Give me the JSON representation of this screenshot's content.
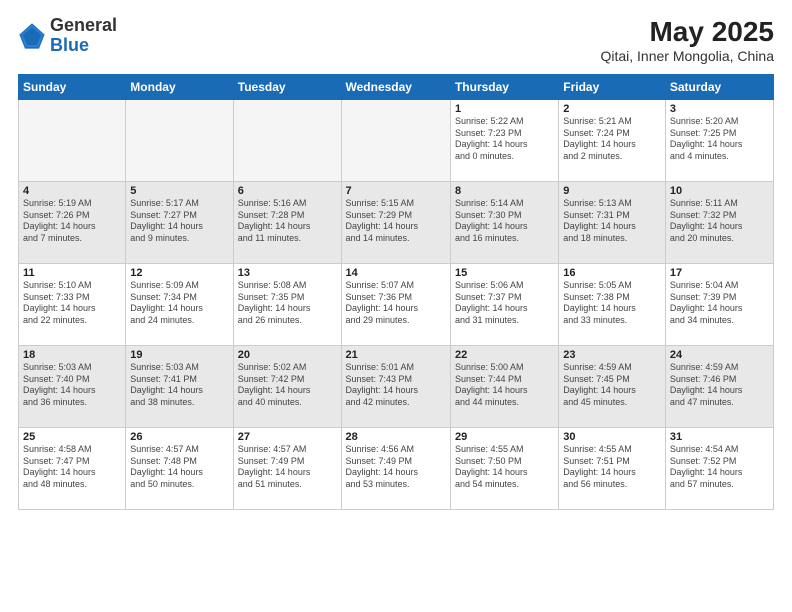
{
  "header": {
    "logo_general": "General",
    "logo_blue": "Blue",
    "title": "May 2025",
    "subtitle": "Qitai, Inner Mongolia, China"
  },
  "days_of_week": [
    "Sunday",
    "Monday",
    "Tuesday",
    "Wednesday",
    "Thursday",
    "Friday",
    "Saturday"
  ],
  "weeks": [
    {
      "shaded": false,
      "days": [
        {
          "num": "",
          "info": ""
        },
        {
          "num": "",
          "info": ""
        },
        {
          "num": "",
          "info": ""
        },
        {
          "num": "",
          "info": ""
        },
        {
          "num": "1",
          "info": "Sunrise: 5:22 AM\nSunset: 7:23 PM\nDaylight: 14 hours\nand 0 minutes."
        },
        {
          "num": "2",
          "info": "Sunrise: 5:21 AM\nSunset: 7:24 PM\nDaylight: 14 hours\nand 2 minutes."
        },
        {
          "num": "3",
          "info": "Sunrise: 5:20 AM\nSunset: 7:25 PM\nDaylight: 14 hours\nand 4 minutes."
        }
      ]
    },
    {
      "shaded": true,
      "days": [
        {
          "num": "4",
          "info": "Sunrise: 5:19 AM\nSunset: 7:26 PM\nDaylight: 14 hours\nand 7 minutes."
        },
        {
          "num": "5",
          "info": "Sunrise: 5:17 AM\nSunset: 7:27 PM\nDaylight: 14 hours\nand 9 minutes."
        },
        {
          "num": "6",
          "info": "Sunrise: 5:16 AM\nSunset: 7:28 PM\nDaylight: 14 hours\nand 11 minutes."
        },
        {
          "num": "7",
          "info": "Sunrise: 5:15 AM\nSunset: 7:29 PM\nDaylight: 14 hours\nand 14 minutes."
        },
        {
          "num": "8",
          "info": "Sunrise: 5:14 AM\nSunset: 7:30 PM\nDaylight: 14 hours\nand 16 minutes."
        },
        {
          "num": "9",
          "info": "Sunrise: 5:13 AM\nSunset: 7:31 PM\nDaylight: 14 hours\nand 18 minutes."
        },
        {
          "num": "10",
          "info": "Sunrise: 5:11 AM\nSunset: 7:32 PM\nDaylight: 14 hours\nand 20 minutes."
        }
      ]
    },
    {
      "shaded": false,
      "days": [
        {
          "num": "11",
          "info": "Sunrise: 5:10 AM\nSunset: 7:33 PM\nDaylight: 14 hours\nand 22 minutes."
        },
        {
          "num": "12",
          "info": "Sunrise: 5:09 AM\nSunset: 7:34 PM\nDaylight: 14 hours\nand 24 minutes."
        },
        {
          "num": "13",
          "info": "Sunrise: 5:08 AM\nSunset: 7:35 PM\nDaylight: 14 hours\nand 26 minutes."
        },
        {
          "num": "14",
          "info": "Sunrise: 5:07 AM\nSunset: 7:36 PM\nDaylight: 14 hours\nand 29 minutes."
        },
        {
          "num": "15",
          "info": "Sunrise: 5:06 AM\nSunset: 7:37 PM\nDaylight: 14 hours\nand 31 minutes."
        },
        {
          "num": "16",
          "info": "Sunrise: 5:05 AM\nSunset: 7:38 PM\nDaylight: 14 hours\nand 33 minutes."
        },
        {
          "num": "17",
          "info": "Sunrise: 5:04 AM\nSunset: 7:39 PM\nDaylight: 14 hours\nand 34 minutes."
        }
      ]
    },
    {
      "shaded": true,
      "days": [
        {
          "num": "18",
          "info": "Sunrise: 5:03 AM\nSunset: 7:40 PM\nDaylight: 14 hours\nand 36 minutes."
        },
        {
          "num": "19",
          "info": "Sunrise: 5:03 AM\nSunset: 7:41 PM\nDaylight: 14 hours\nand 38 minutes."
        },
        {
          "num": "20",
          "info": "Sunrise: 5:02 AM\nSunset: 7:42 PM\nDaylight: 14 hours\nand 40 minutes."
        },
        {
          "num": "21",
          "info": "Sunrise: 5:01 AM\nSunset: 7:43 PM\nDaylight: 14 hours\nand 42 minutes."
        },
        {
          "num": "22",
          "info": "Sunrise: 5:00 AM\nSunset: 7:44 PM\nDaylight: 14 hours\nand 44 minutes."
        },
        {
          "num": "23",
          "info": "Sunrise: 4:59 AM\nSunset: 7:45 PM\nDaylight: 14 hours\nand 45 minutes."
        },
        {
          "num": "24",
          "info": "Sunrise: 4:59 AM\nSunset: 7:46 PM\nDaylight: 14 hours\nand 47 minutes."
        }
      ]
    },
    {
      "shaded": false,
      "days": [
        {
          "num": "25",
          "info": "Sunrise: 4:58 AM\nSunset: 7:47 PM\nDaylight: 14 hours\nand 48 minutes."
        },
        {
          "num": "26",
          "info": "Sunrise: 4:57 AM\nSunset: 7:48 PM\nDaylight: 14 hours\nand 50 minutes."
        },
        {
          "num": "27",
          "info": "Sunrise: 4:57 AM\nSunset: 7:49 PM\nDaylight: 14 hours\nand 51 minutes."
        },
        {
          "num": "28",
          "info": "Sunrise: 4:56 AM\nSunset: 7:49 PM\nDaylight: 14 hours\nand 53 minutes."
        },
        {
          "num": "29",
          "info": "Sunrise: 4:55 AM\nSunset: 7:50 PM\nDaylight: 14 hours\nand 54 minutes."
        },
        {
          "num": "30",
          "info": "Sunrise: 4:55 AM\nSunset: 7:51 PM\nDaylight: 14 hours\nand 56 minutes."
        },
        {
          "num": "31",
          "info": "Sunrise: 4:54 AM\nSunset: 7:52 PM\nDaylight: 14 hours\nand 57 minutes."
        }
      ]
    }
  ]
}
